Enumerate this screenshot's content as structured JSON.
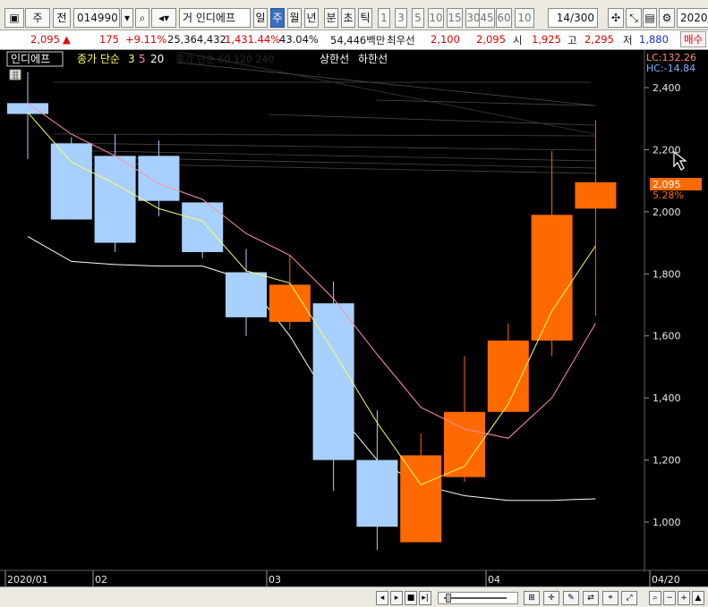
{
  "toolbar": {
    "period_type": "주",
    "prev_label": "전",
    "code": "014990",
    "search_icon": "search-icon",
    "sound_icon": "speaker-icon",
    "stock_name": "거 인디에프",
    "periods": [
      "일",
      "주",
      "월",
      "년",
      "분",
      "초",
      "틱"
    ],
    "selected_period": "주",
    "minute_options": [
      "1",
      "3",
      "5",
      "10",
      "15",
      "30",
      "45",
      "60"
    ],
    "tick_value": "10",
    "count_current": "14",
    "count_total": "/300",
    "date_value": "2020/"
  },
  "quote": {
    "price": "2,095",
    "arrow": "▲",
    "change": "175",
    "change_pct": "+9.11%",
    "volume": "25,364,432",
    "volume_pct": "1,431.44%",
    "turnover": "43.04%",
    "amount": "54,446백만",
    "best_ask_label": "최우선",
    "best_ask_1": "2,100",
    "best_ask_2": "2,095",
    "open_label": "시",
    "open_value": "1,925",
    "high_label": "고",
    "high_value": "2,295",
    "low_label": "저",
    "low_value": "1,880",
    "buy_label": "매수"
  },
  "legend": {
    "name": "인디에프",
    "ma_label": "종가 단순",
    "ma_periods": [
      "3",
      "5",
      "20"
    ],
    "hidden_label": "종가 단순 60 120 240",
    "upper_limit": "상한선",
    "lower_limit": "하한선"
  },
  "right_labels": {
    "lc": "LC:132.26",
    "hc": "HC:-14.84",
    "last_price": "2,095",
    "last_pct": "5.28%"
  },
  "colors": {
    "up": "#ff6a00",
    "down": "#a8d0ff",
    "ma3": "#ffff66",
    "ma5": "#ff8fa8",
    "ma20": "#fffff0",
    "background": "#000000"
  },
  "chart_data": {
    "type": "candlestick",
    "y_ticks": [
      "2,400",
      "2,200",
      "2,000",
      "1,800",
      "1,600",
      "1,400",
      "1,200",
      "1,000"
    ],
    "y_tick_values": [
      2400,
      2200,
      2000,
      1800,
      1600,
      1400,
      1200,
      1000
    ],
    "ylim": [
      850,
      2550
    ],
    "x_labels": [
      {
        "label": "2020/01",
        "index": 0
      },
      {
        "label": "02",
        "index": 2
      },
      {
        "label": "03",
        "index": 6
      },
      {
        "label": "04",
        "index": 11
      },
      {
        "label": "04/20",
        "index": 14
      }
    ],
    "candles": [
      {
        "open": 2350,
        "close": 2315,
        "high": 2450,
        "low": 2170
      },
      {
        "open": 2220,
        "close": 1975,
        "high": 2240,
        "low": 1975
      },
      {
        "open": 2180,
        "close": 1900,
        "high": 2250,
        "low": 1870
      },
      {
        "open": 2180,
        "close": 2035,
        "high": 2230,
        "low": 1985
      },
      {
        "open": 2030,
        "close": 1870,
        "high": 2030,
        "low": 1850
      },
      {
        "open": 1805,
        "close": 1660,
        "high": 1880,
        "low": 1600
      },
      {
        "open": 1645,
        "close": 1765,
        "high": 1860,
        "low": 1620
      },
      {
        "open": 1705,
        "close": 1200,
        "high": 1775,
        "low": 1100
      },
      {
        "open": 1200,
        "close": 985,
        "high": 1360,
        "low": 910
      },
      {
        "open": 935,
        "close": 1215,
        "high": 1285,
        "low": 935
      },
      {
        "open": 1145,
        "close": 1355,
        "high": 1535,
        "low": 1130
      },
      {
        "open": 1355,
        "close": 1585,
        "high": 1640,
        "low": 1355
      },
      {
        "open": 1585,
        "close": 1990,
        "high": 2195,
        "low": 1535
      },
      {
        "open": 2010,
        "close": 2095,
        "high": 2295,
        "low": 1665
      }
    ],
    "ma3": [
      2320,
      2160,
      2090,
      2010,
      1970,
      1810,
      1770,
      1550,
      1320,
      1120,
      1180,
      1380,
      1680,
      1890
    ],
    "ma5": [
      2350,
      2250,
      2180,
      2090,
      2040,
      1930,
      1860,
      1720,
      1540,
      1370,
      1300,
      1270,
      1400,
      1640
    ],
    "ma20": [
      1920,
      1840,
      1830,
      1825,
      1825,
      1780,
      1600,
      1370,
      1200,
      1120,
      1085,
      1070,
      1070,
      1075
    ]
  }
}
